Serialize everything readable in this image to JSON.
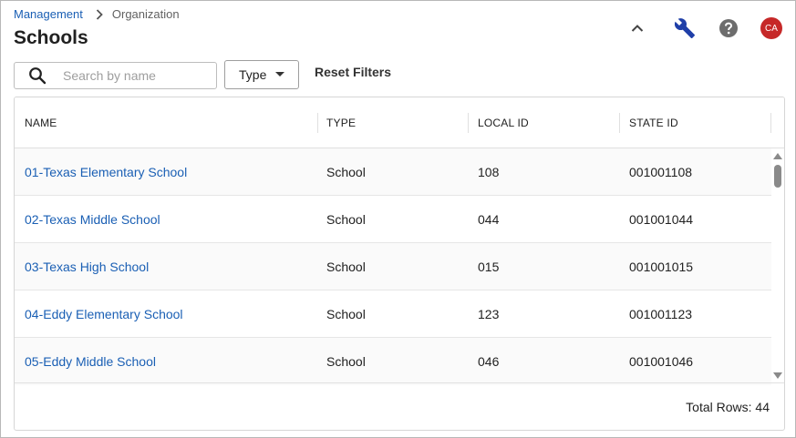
{
  "breadcrumb": {
    "parent": "Management",
    "current": "Organization"
  },
  "page": {
    "title": "Schools"
  },
  "header": {
    "user_initials": "CA",
    "avatar_color": "#c62828"
  },
  "filters": {
    "search_placeholder": "Search by name",
    "search_value": "",
    "type_label": "Type",
    "reset_label": "Reset Filters"
  },
  "table": {
    "columns": [
      "NAME",
      "TYPE",
      "LOCAL ID",
      "STATE ID"
    ],
    "rows": [
      {
        "name": "01-Texas Elementary School",
        "type": "School",
        "local_id": "108",
        "state_id": "001001108"
      },
      {
        "name": "02-Texas Middle School",
        "type": "School",
        "local_id": "044",
        "state_id": "001001044"
      },
      {
        "name": "03-Texas High School",
        "type": "School",
        "local_id": "015",
        "state_id": "001001015"
      },
      {
        "name": "04-Eddy Elementary School",
        "type": "School",
        "local_id": "123",
        "state_id": "001001123"
      },
      {
        "name": "05-Eddy Middle School",
        "type": "School",
        "local_id": "046",
        "state_id": "001001046"
      }
    ],
    "footer_total": "Total Rows: 44"
  },
  "colors": {
    "link": "#1a5fb4",
    "accent_icon": "#1f3fa8"
  },
  "icons": {
    "breadcrumb_separator": "chevron-right-icon",
    "collapse": "chevron-up-icon",
    "tools": "wrench-icon",
    "help": "help-circle-icon",
    "search": "search-icon",
    "type_dropdown": "caret-down-icon",
    "scroll_up": "scroll-up-arrow-icon",
    "scroll_down": "scroll-down-arrow-icon"
  }
}
